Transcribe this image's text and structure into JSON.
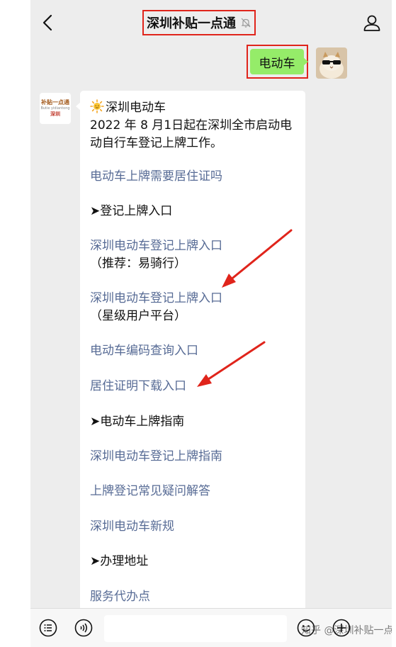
{
  "header": {
    "title": "深圳补贴一点通"
  },
  "user_message": {
    "text": "电动车"
  },
  "bot": {
    "avatar_text": {
      "main": "补贴一点通",
      "sub": "Butie yidiantong",
      "city": "深圳"
    },
    "heading": "深圳电动车",
    "intro": "2022年8月1日起在深圳全市启动电动自行车登记上牌工作。",
    "intro_line1": "2022 年 8 月1日起在深圳全市启动电",
    "intro_line2": "动自行车登记上牌工作。",
    "items": [
      {
        "text": "电动车上牌需要居住证吗",
        "type": "link"
      },
      {
        "text": "➤登记上牌入口",
        "type": "plain"
      },
      {
        "text": "深圳电动车登记上牌入口",
        "type": "link"
      },
      {
        "text": "（推荐：易骑行）",
        "type": "sub"
      },
      {
        "text": "深圳电动车登记上牌入口",
        "type": "link"
      },
      {
        "text": "（星级用户平台）",
        "type": "sub"
      },
      {
        "text": "电动车编码查询入口",
        "type": "link"
      },
      {
        "text": "居住证明下载入口",
        "type": "link"
      },
      {
        "text": "➤电动车上牌指南",
        "type": "plain"
      },
      {
        "text": "深圳电动车登记上牌指南",
        "type": "link"
      },
      {
        "text": "上牌登记常见疑问解答",
        "type": "link"
      },
      {
        "text": "深圳电动车新规",
        "type": "link"
      },
      {
        "text": "➤办理地址",
        "type": "plain"
      },
      {
        "text": "服务代办点",
        "type": "link"
      }
    ]
  },
  "watermark": "知乎 @深圳补贴一点通",
  "colors": {
    "background": "#ededed",
    "link": "#576b95",
    "user_bubble": "#95ec69",
    "highlight": "#e0241b"
  },
  "icons": {
    "back": "chevron-left-icon",
    "mute": "bell-off-icon",
    "profile": "person-icon",
    "menu": "list-icon",
    "voice": "voice-icon",
    "emoji": "smile-icon",
    "add": "plus-icon",
    "sun": "sun-icon"
  }
}
